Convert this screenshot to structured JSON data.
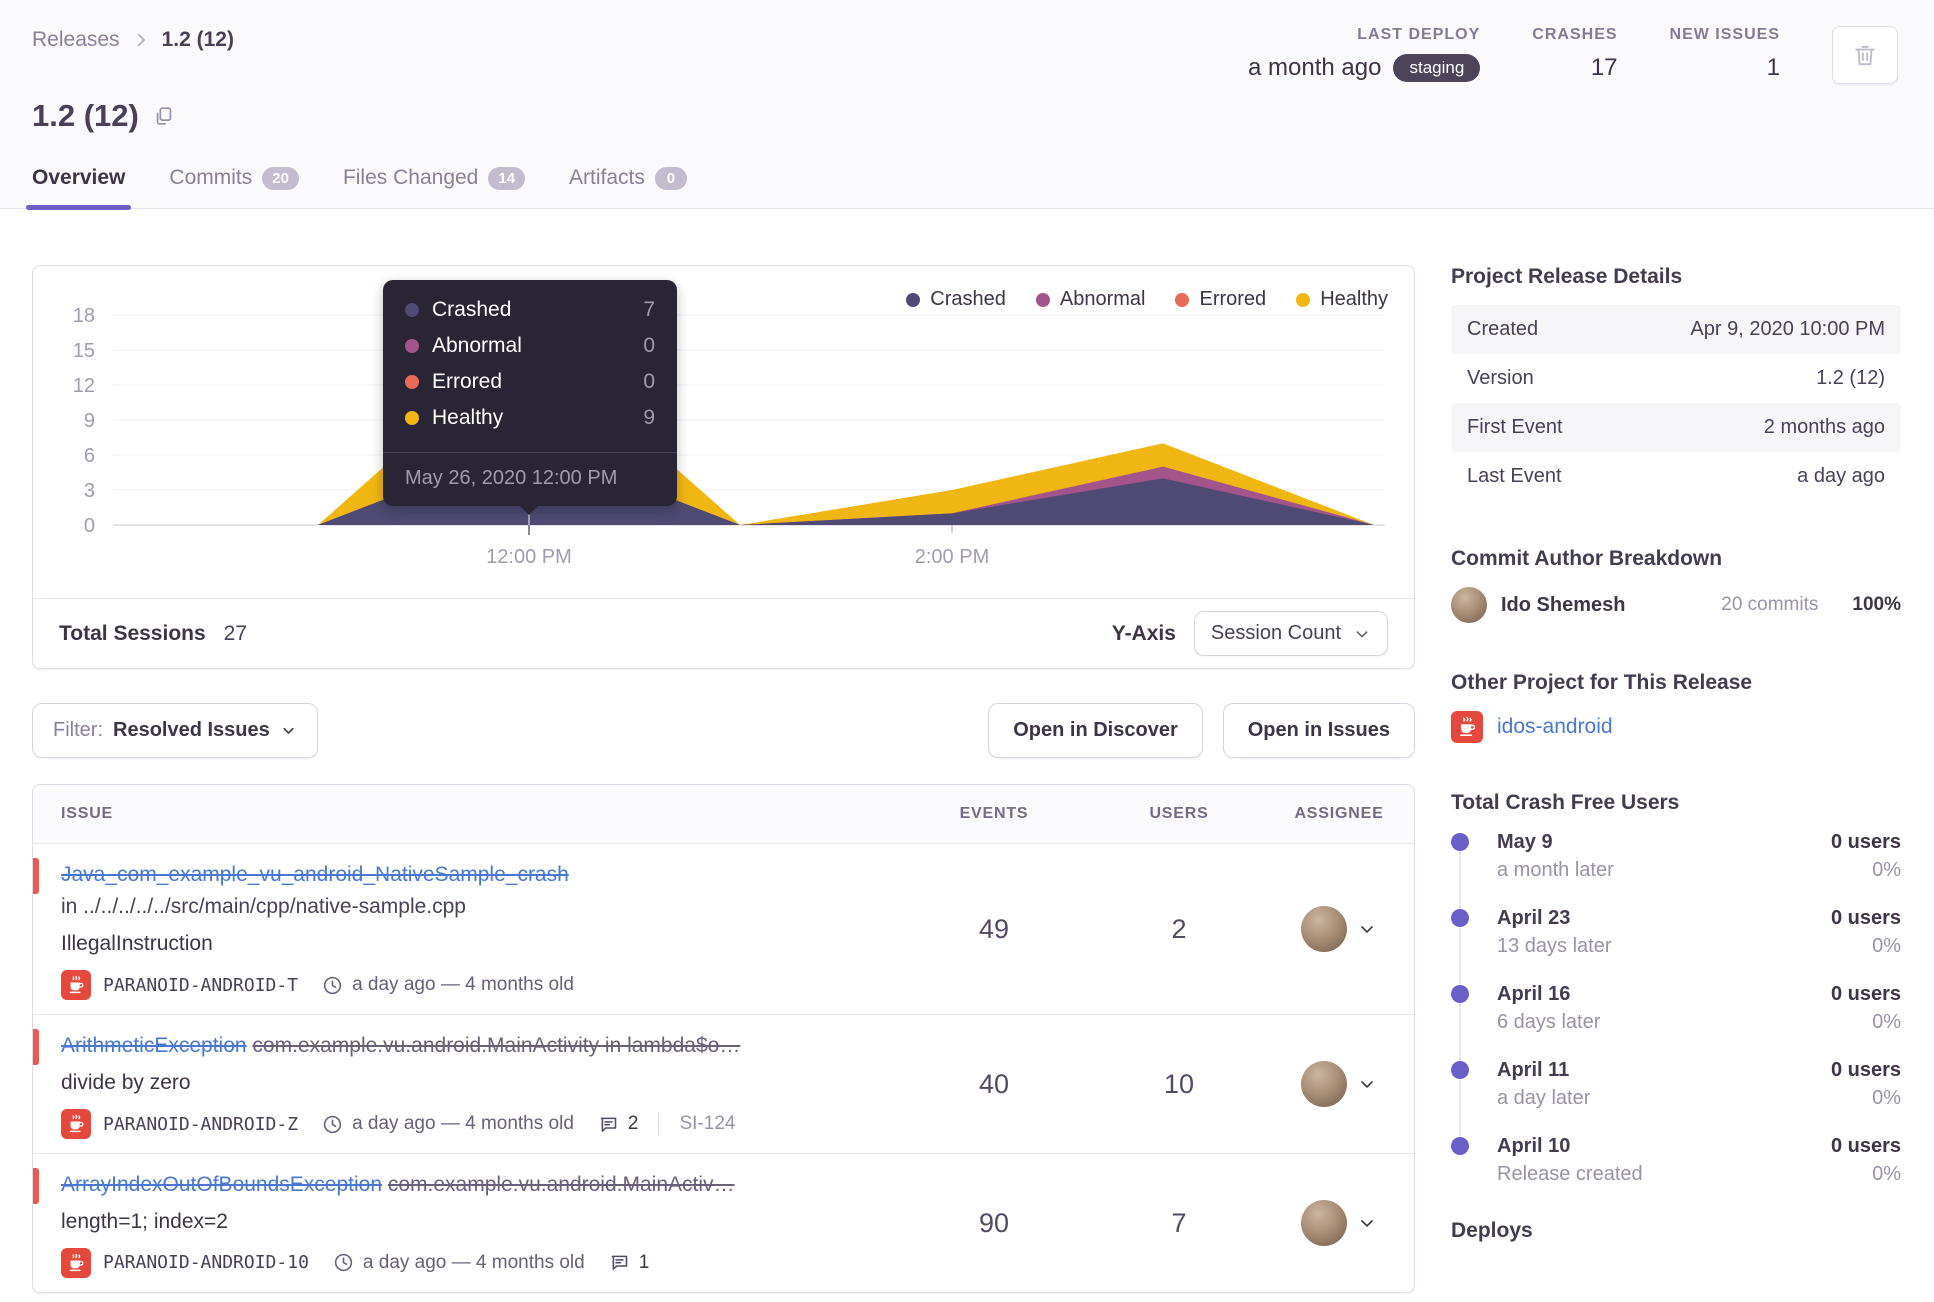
{
  "breadcrumb": {
    "parent": "Releases",
    "current": "1.2 (12)"
  },
  "header": {
    "title": "1.2 (12)",
    "stats": [
      {
        "label": "LAST DEPLOY",
        "value": "a month ago",
        "badge": "staging"
      },
      {
        "label": "CRASHES",
        "value": "17"
      },
      {
        "label": "NEW ISSUES",
        "value": "1"
      }
    ]
  },
  "tabs": [
    {
      "label": "Overview",
      "count": null,
      "active": true
    },
    {
      "label": "Commits",
      "count": "20",
      "active": false
    },
    {
      "label": "Files Changed",
      "count": "14",
      "active": false
    },
    {
      "label": "Artifacts",
      "count": "0",
      "active": false
    }
  ],
  "chart_data": {
    "type": "area",
    "stacked": true,
    "x": [
      "11:00 AM",
      "12:00 PM",
      "1:00 PM",
      "2:00 PM",
      "3:00 PM",
      "4:00 PM"
    ],
    "series": [
      {
        "name": "Crashed",
        "color": "#4e4a73",
        "values": [
          0,
          7,
          0,
          1,
          4,
          0
        ]
      },
      {
        "name": "Abnormal",
        "color": "#a3548a",
        "values": [
          0,
          0,
          0,
          0,
          1,
          0
        ]
      },
      {
        "name": "Errored",
        "color": "#ea6a5a",
        "values": [
          0,
          0,
          0,
          0,
          0,
          0
        ]
      },
      {
        "name": "Healthy",
        "color": "#f0b712",
        "values": [
          0,
          9,
          0,
          2,
          2,
          0
        ]
      }
    ],
    "ylabel": "Session Count",
    "ylim": [
      0,
      19
    ],
    "yticks": [
      0,
      3,
      6,
      9,
      12,
      15,
      18
    ],
    "xticks_visible": [
      "12:00 PM",
      "2:00 PM"
    ],
    "legend_position": "top-right",
    "grid": true
  },
  "tooltip": {
    "rows": [
      {
        "label": "Crashed",
        "value": "7"
      },
      {
        "label": "Abnormal",
        "value": "0"
      },
      {
        "label": "Errored",
        "value": "0"
      },
      {
        "label": "Healthy",
        "value": "9"
      }
    ],
    "date": "May 26, 2020 12:00 PM",
    "hover_x": "12:00 PM"
  },
  "chart_footer": {
    "total_label": "Total Sessions",
    "total_value": "27",
    "yaxis_label": "Y-Axis",
    "yaxis_value": "Session Count"
  },
  "filter_bar": {
    "filter_prefix": "Filter:",
    "filter_value": "Resolved Issues",
    "open_discover": "Open in Discover",
    "open_issues": "Open in Issues"
  },
  "issues": {
    "columns": [
      "ISSUE",
      "EVENTS",
      "USERS",
      "ASSIGNEE"
    ],
    "rows": [
      {
        "title": "Java_com_example_vu_android_NativeSample_crash",
        "culprit": "in ../../../../../src/main/cpp/native-sample.cpp",
        "culprit_block": true,
        "culprit_struck": false,
        "message": "IllegalInstruction",
        "project": "PARANOID-ANDROID-T",
        "age": "a day ago — 4 months old",
        "comments": "",
        "annotation": "",
        "events": "49",
        "users": "2"
      },
      {
        "title": "ArithmeticException",
        "culprit": "com.example.vu.android.MainActivity in lambda$o…",
        "culprit_block": false,
        "culprit_struck": true,
        "message": "divide by zero",
        "project": "PARANOID-ANDROID-Z",
        "age": "a day ago — 4 months old",
        "comments": "2",
        "annotation": "SI-124",
        "events": "40",
        "users": "10"
      },
      {
        "title": "ArrayIndexOutOfBoundsException",
        "culprit": "com.example.vu.android.MainActiv…",
        "culprit_block": false,
        "culprit_struck": true,
        "message": "length=1; index=2",
        "project": "PARANOID-ANDROID-10",
        "age": "a day ago — 4 months old",
        "comments": "1",
        "annotation": "",
        "events": "90",
        "users": "7"
      }
    ]
  },
  "sidebar": {
    "release_details": {
      "heading": "Project Release Details",
      "rows": [
        {
          "label": "Created",
          "value": "Apr 9, 2020 10:00 PM"
        },
        {
          "label": "Version",
          "value": "1.2 (12)"
        },
        {
          "label": "First Event",
          "value": "2 months ago"
        },
        {
          "label": "Last Event",
          "value": "a day ago"
        }
      ]
    },
    "commit_authors": {
      "heading": "Commit Author Breakdown",
      "authors": [
        {
          "name": "Ido Shemesh",
          "commits": "20 commits",
          "percent": "100%"
        }
      ]
    },
    "other_project": {
      "heading": "Other Project for This Release",
      "project": "idos-android"
    },
    "crash_free": {
      "heading": "Total Crash Free Users",
      "items": [
        {
          "date": "May 9",
          "sub": "a month later",
          "users": "0 users",
          "percent": "0%"
        },
        {
          "date": "April 23",
          "sub": "13 days later",
          "users": "0 users",
          "percent": "0%"
        },
        {
          "date": "April 16",
          "sub": "6 days later",
          "users": "0 users",
          "percent": "0%"
        },
        {
          "date": "April 11",
          "sub": "a day later",
          "users": "0 users",
          "percent": "0%"
        },
        {
          "date": "April 10",
          "sub": "Release created",
          "users": "0 users",
          "percent": "0%"
        }
      ]
    },
    "deploys_heading": "Deploys"
  },
  "colors": {
    "accent": "#6d5fc7",
    "link": "#4877d4",
    "unhandled_red": "#e8594f",
    "java_red": "#e5483d",
    "tooltip_bg": "#2a2534"
  }
}
